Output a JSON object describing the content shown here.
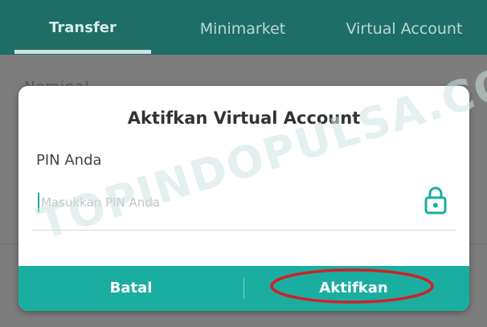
{
  "tabs": [
    {
      "label": "Transfer",
      "active": true
    },
    {
      "label": "Minimarket",
      "active": false
    },
    {
      "label": "Virtual Account",
      "active": false
    }
  ],
  "background": {
    "hint": "Nominal"
  },
  "dialog": {
    "title": "Aktifkan Virtual Account",
    "pin_label": "PIN Anda",
    "pin_placeholder": "Masukkan PIN Anda",
    "pin_value": "",
    "lock_icon": "lock-icon",
    "cancel_label": "Batal",
    "confirm_label": "Aktifkan"
  },
  "colors": {
    "accent": "#19aea0",
    "appbar": "#1d6e66",
    "highlight": "#d0202a"
  },
  "watermark": "TOPINDOPULSA.COM"
}
